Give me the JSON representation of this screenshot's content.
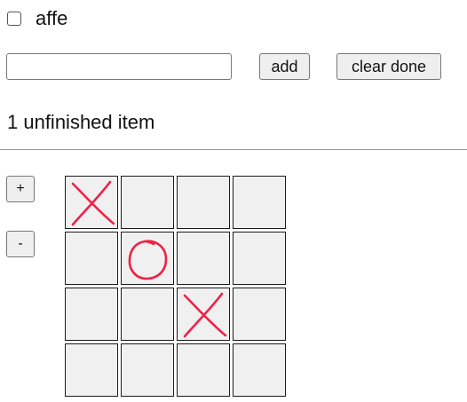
{
  "todo": {
    "items": [
      {
        "label": "affe",
        "checked": false
      }
    ],
    "input": {
      "value": "",
      "placeholder": ""
    },
    "add_label": "add",
    "clear_label": "clear done",
    "remaining_text": "1 unfinished item"
  },
  "board": {
    "plus_label": "+",
    "minus_label": "-",
    "size": 4,
    "cells": [
      [
        "X",
        "",
        "",
        ""
      ],
      [
        "",
        "O",
        "",
        ""
      ],
      [
        "",
        "",
        "X",
        ""
      ],
      [
        "",
        "",
        "",
        ""
      ]
    ],
    "mark_color": "#ee2244"
  }
}
